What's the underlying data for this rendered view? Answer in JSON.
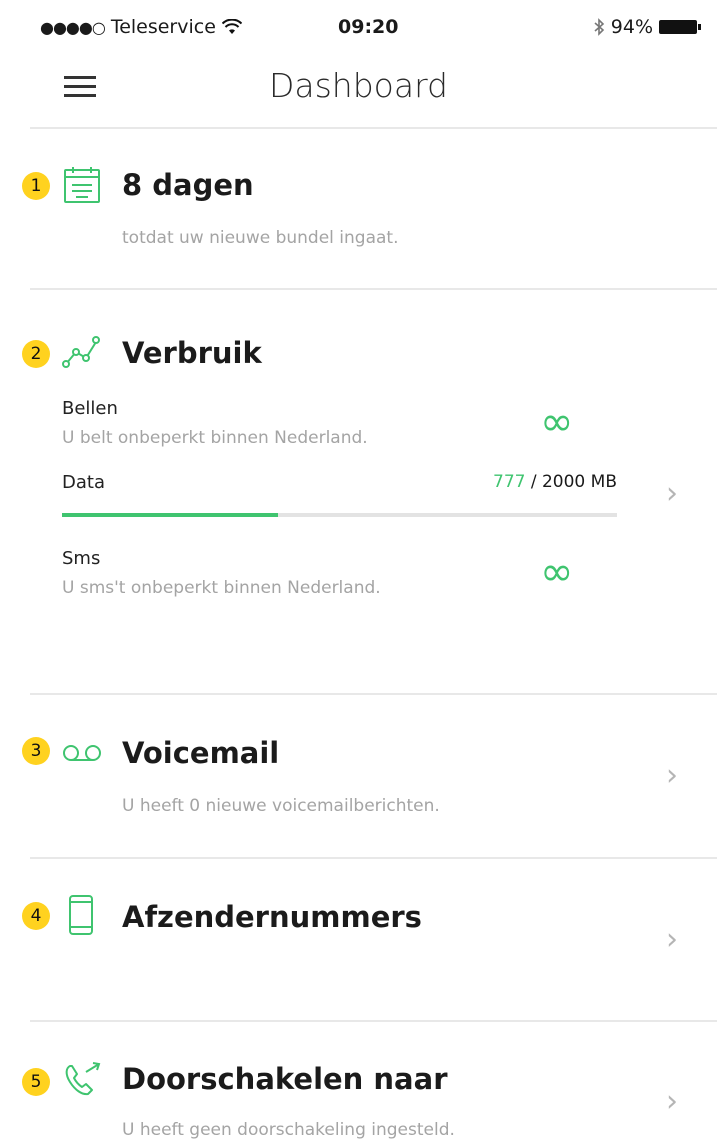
{
  "status_bar": {
    "signal_dots": "●●●●○",
    "carrier": "Teleservice",
    "time": "09:20",
    "battery": "94%"
  },
  "nav": {
    "title": "Dashboard"
  },
  "sections": [
    {
      "badge": "1",
      "title": "8 dagen",
      "subtitle": "totdat uw nieuwe bundel ingaat."
    },
    {
      "badge": "2",
      "title": "Verbruik",
      "items": [
        {
          "label": "Bellen",
          "desc": "U belt onbeperkt binnen Nederland.",
          "value": "∞"
        },
        {
          "label": "Data",
          "used": "777",
          "total": " / 2000 MB",
          "progress": 0.3885
        },
        {
          "label": "Sms",
          "desc": "U sms't onbeperkt binnen Nederland.",
          "value": "∞"
        }
      ]
    },
    {
      "badge": "3",
      "title": "Voicemail",
      "subtitle": "U heeft 0 nieuwe voicemailberichten."
    },
    {
      "badge": "4",
      "title": "Afzendernummers"
    },
    {
      "badge": "5",
      "title": "Doorschakelen naar",
      "subtitle": "U heeft geen doorschakeling ingesteld."
    }
  ],
  "chevron": "›",
  "accent_color": "#3fc46f",
  "badge_color": "#ffd21f"
}
